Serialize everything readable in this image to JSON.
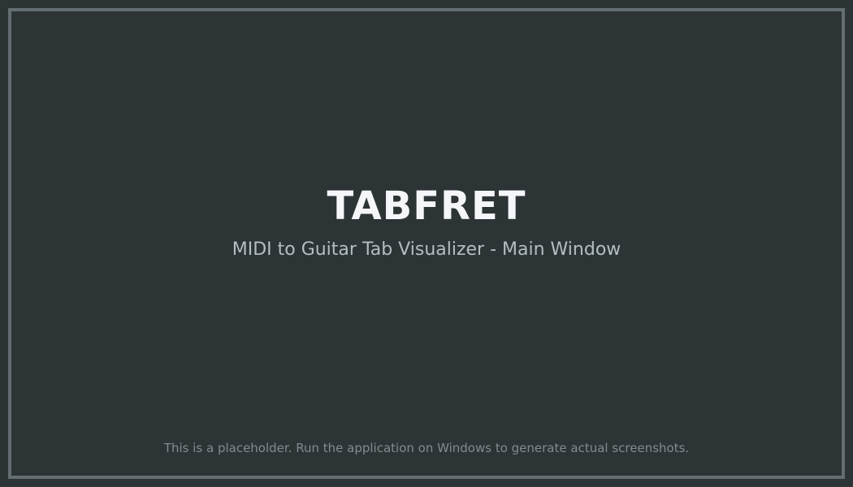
{
  "app": {
    "title": "TABFRET",
    "subtitle": "MIDI to Guitar Tab Visualizer - Main Window"
  },
  "footer": {
    "note": "This is a placeholder. Run the application on Windows to generate actual screenshots."
  },
  "colors": {
    "background": "#2d3436",
    "border": "#636e72",
    "title": "#f5f6fa",
    "subtitle": "#b2bec3",
    "footer": "#7f8c8d"
  }
}
